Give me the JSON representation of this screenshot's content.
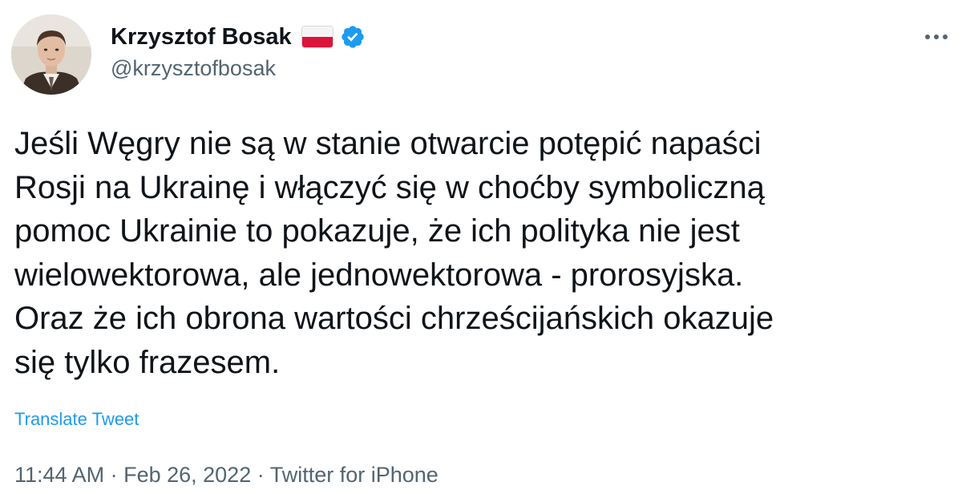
{
  "author": {
    "display_name": "Krzysztof Bosak",
    "handle": "@krzysztofbosak",
    "flag_icon": "poland-flag-icon",
    "verified_icon": "verified-badge-icon",
    "verified_color": "#1d9bf0"
  },
  "tweet": {
    "lines": [
      "Jeśli Węgry nie są w stanie otwarcie potępić napaści",
      "Rosji na Ukrainę i włączyć się w choćby symboliczną",
      "pomoc Ukrainie to pokazuje, że ich polityka nie jest",
      "wielowektorowa, ale jednowektorowa - prorosyjska.",
      "Oraz że ich obrona wartości chrześcijańskich okazuje",
      "się tylko frazesem."
    ],
    "translate_label": "Translate Tweet"
  },
  "meta": {
    "time": "11:44 AM",
    "separator": " · ",
    "date": "Feb 26, 2022",
    "source": "Twitter for iPhone"
  },
  "colors": {
    "text": "#0f1419",
    "secondary": "#536471",
    "link": "#1d9bf0"
  }
}
